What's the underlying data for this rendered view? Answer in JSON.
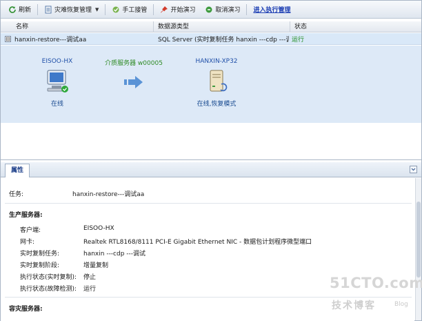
{
  "toolbar": {
    "refresh": "刷新",
    "dr_manage": "灾难恢复管理",
    "manual_takeover": "手工接管",
    "start_drill": "开始演习",
    "cancel_drill": "取消演习",
    "exec_manage": "进入执行管理"
  },
  "grid": {
    "col_name": "名称",
    "col_type": "数据源类型",
    "col_status": "状态",
    "row": {
      "expander": "⊟",
      "name": "hanxin-restore---调试aa",
      "type": "SQL Server (实时复制任务 hanxin ---cdp ---调试",
      "status": "运行"
    }
  },
  "topology": {
    "source": {
      "name": "EISOO-HX",
      "state": "在线"
    },
    "media": {
      "name": "介质服务器 w00005"
    },
    "target": {
      "name": "HANXIN-XP32",
      "state": "在线,恢复模式"
    }
  },
  "properties": {
    "tab": "属性",
    "task_label": "任务:",
    "task_value": "hanxin-restore---调试aa",
    "prod_section": "生产服务器:",
    "fields": [
      {
        "label": "客户端:",
        "value": "EISOO-HX"
      },
      {
        "label": "网卡:",
        "value": "Realtek RTL8168/8111 PCI-E Gigabit Ethernet NIC - 数据包计划程序微型端口"
      },
      {
        "label": "实时复制任务:",
        "value": "hanxin ---cdp ---调试"
      },
      {
        "label": "实时复制阶段:",
        "value": "增量复制"
      },
      {
        "label": "执行状态(实时复制):",
        "value": "停止"
      },
      {
        "label": "执行状态(故障检测):",
        "value": "运行"
      }
    ],
    "dr_section": "容灾服务器:"
  },
  "watermark": {
    "site": "51CTO.com",
    "cn": "技术博客",
    "blog": "Blog"
  }
}
